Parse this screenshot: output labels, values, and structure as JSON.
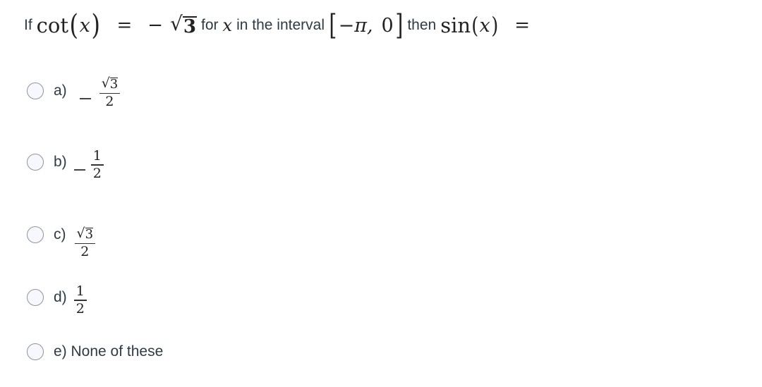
{
  "question": {
    "prefix": "If",
    "cot_fn": "cot",
    "var": "x",
    "open_paren": "(",
    "close_paren": ")",
    "equals": "=",
    "neg": "−",
    "sqrt_symbol": "√",
    "sqrt_arg": "3",
    "for_text": "for",
    "interval_text": "in the interval",
    "open_bracket": "[",
    "neg_pi": "−π,",
    "zero": "0",
    "close_bracket": "]",
    "then_text": "then",
    "sin_fn": "sin"
  },
  "options": [
    {
      "label": "a)",
      "negative": true,
      "numerator_sqrt": true,
      "numerator": "3",
      "denominator": "2",
      "selected": false
    },
    {
      "label": "b)",
      "negative": true,
      "numerator_sqrt": false,
      "numerator": "1",
      "denominator": "2",
      "selected": false
    },
    {
      "label": "c)",
      "negative": false,
      "numerator_sqrt": true,
      "numerator": "3",
      "denominator": "2",
      "selected": false
    },
    {
      "label": "d)",
      "negative": false,
      "numerator_sqrt": false,
      "numerator": "1",
      "denominator": "2",
      "selected": false
    },
    {
      "label": "e) None of these",
      "text_only": true,
      "selected": false
    }
  ],
  "symbols": {
    "sqrt": "√"
  }
}
